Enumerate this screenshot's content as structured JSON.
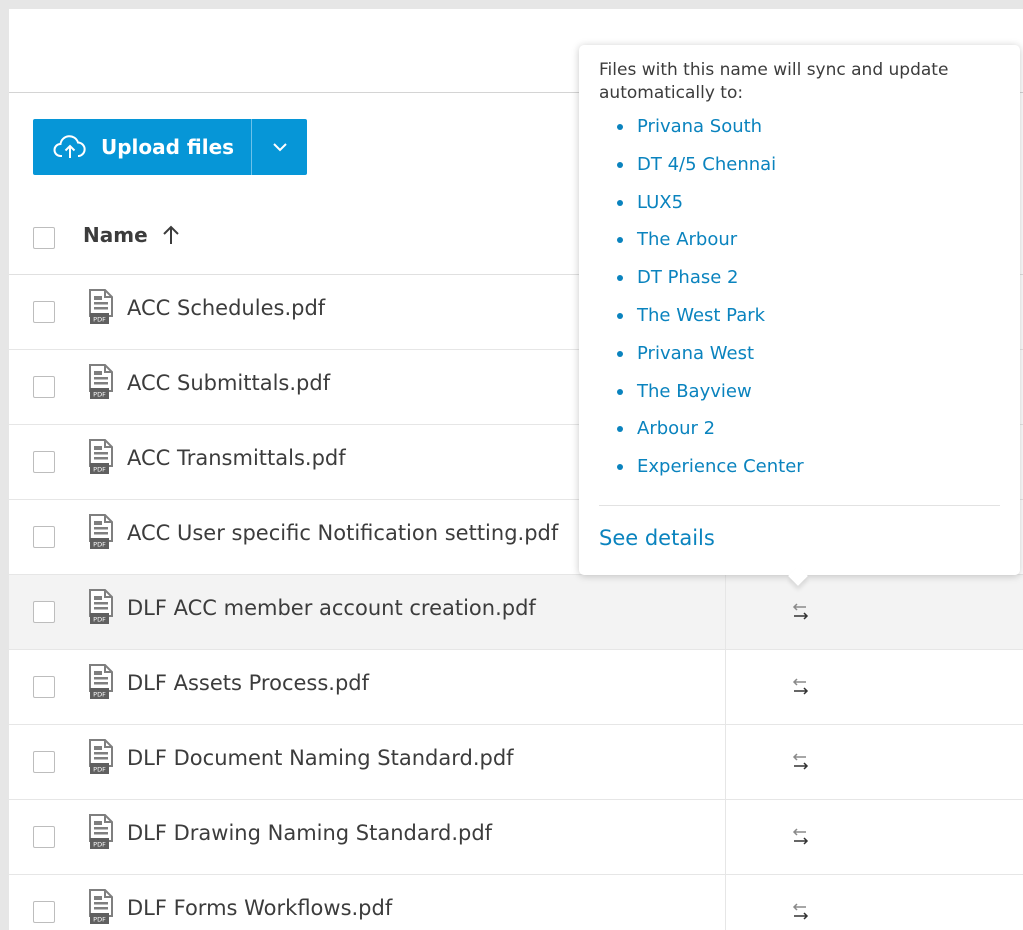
{
  "toolbar": {
    "upload_label": "Upload files"
  },
  "table": {
    "name_header": "Name",
    "rows": [
      {
        "name": "ACC Schedules.pdf"
      },
      {
        "name": "ACC Submittals.pdf"
      },
      {
        "name": "ACC Transmittals.pdf"
      },
      {
        "name": "ACC User specific Notification setting.pdf"
      },
      {
        "name": "DLF ACC member account creation.pdf"
      },
      {
        "name": "DLF Assets Process.pdf"
      },
      {
        "name": "DLF Document Naming Standard.pdf"
      },
      {
        "name": "DLF Drawing Naming Standard.pdf"
      },
      {
        "name": "DLF Forms Workflows.pdf"
      }
    ]
  },
  "popover": {
    "intro": "Files with this name will sync and update automatically to:",
    "projects": [
      "Privana South",
      "DT 4/5 Chennai",
      "LUX5",
      "The Arbour",
      "DT Phase 2",
      "The West Park",
      "Privana West",
      "The Bayview",
      "Arbour 2",
      "Experience Center"
    ],
    "see_details": "See details"
  },
  "icons": {
    "file": "pdf-file-icon",
    "sync": "sync-arrows-icon",
    "upload": "cloud-upload-icon",
    "sort": "sort-ascending-icon",
    "caret": "chevron-down-icon"
  },
  "colors": {
    "primary": "#0696d7",
    "link": "#0a83be",
    "row_hover": "#f3f3f3"
  }
}
